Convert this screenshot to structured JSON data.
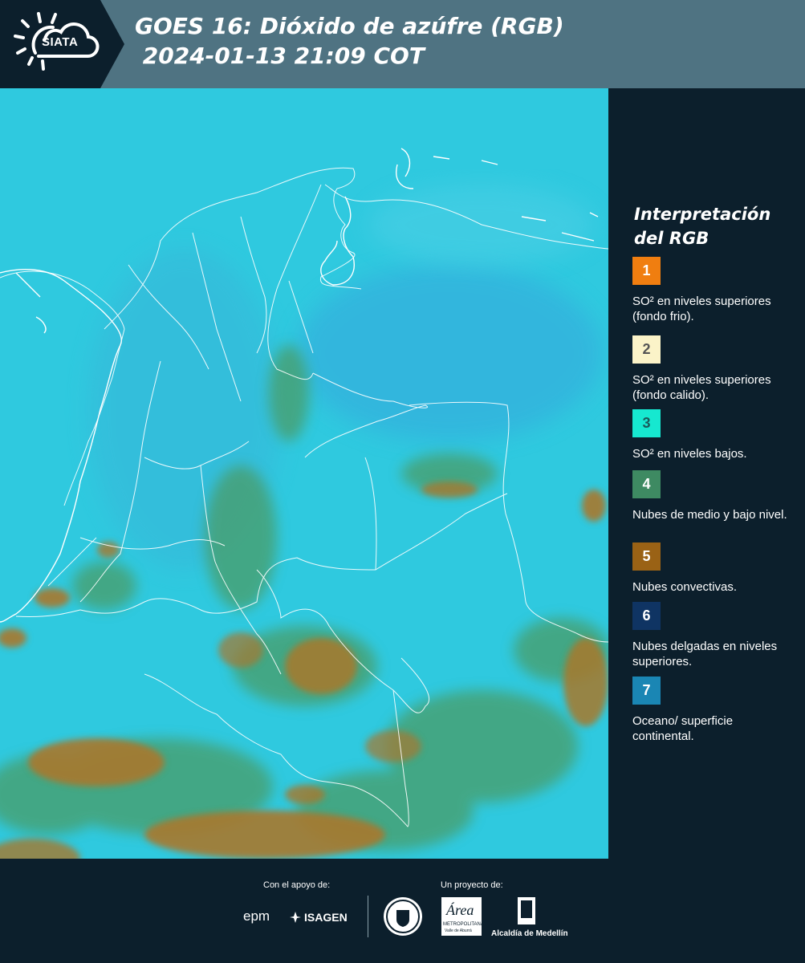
{
  "header": {
    "logo_text": "SIATA",
    "title_line1": "GOES 16: Dióxido de azúfre (RGB)",
    "title_line2": " 2024-01-13 21:09 COT"
  },
  "legend": {
    "title": "Interpretación del RGB",
    "items": [
      {
        "number": "1",
        "color": "#f07e10",
        "label": "SO² en niveles superiores (fondo frio)."
      },
      {
        "number": "2",
        "color": "#fbf3c8",
        "label": "SO² en niveles superiores (fondo calido)."
      },
      {
        "number": "3",
        "color": "#16e8d0",
        "label": "SO² en niveles bajos."
      },
      {
        "number": "4",
        "color": "#3e8a62",
        "label": "Nubes de medio y bajo nivel."
      },
      {
        "number": "5",
        "color": "#9a6215",
        "label": "Nubes convectivas."
      },
      {
        "number": "6",
        "color": "#0f3463",
        "label": "Nubes delgadas en niveles superiores."
      },
      {
        "number": "7",
        "color": "#1a86b4",
        "label": "Oceano/ superficie continental."
      }
    ]
  },
  "footer": {
    "support_label": "Con el apoyo de:",
    "project_label": "Un proyecto de:",
    "sponsor1": "epm",
    "sponsor2": "ISAGEN",
    "partner_area": "Área",
    "partner_area_sub": "METROPOLITANA",
    "partner_area_sub2": "Valle de Aburrá",
    "partner_alcaldia": "Alcaldía de Medellín"
  },
  "colors": {
    "ocean": "#2fc9df",
    "land_tint": "#3ab9d8",
    "convective": "#a8782c",
    "mid_cloud": "#4b9a60",
    "header_bg": "#4f7382",
    "page_bg": "#0c1f2c"
  }
}
